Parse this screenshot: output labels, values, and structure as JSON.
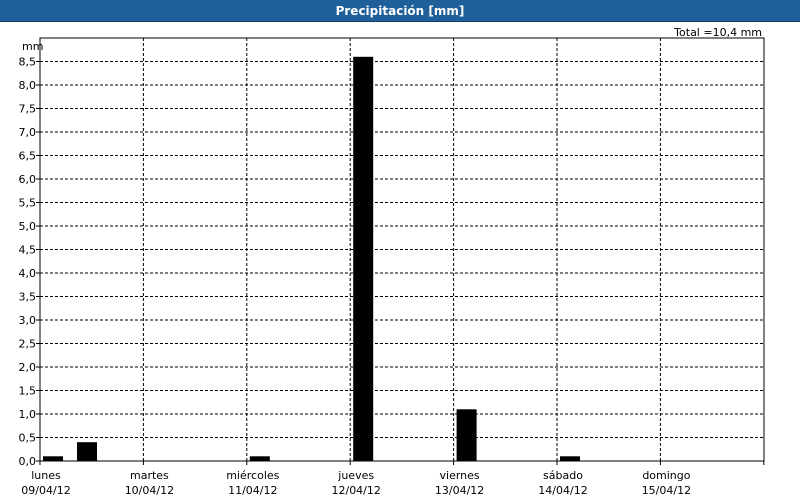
{
  "window": {
    "title": "Precipitación [mm]"
  },
  "total_label": "Total =10,4 mm",
  "chart_data": {
    "type": "bar",
    "title": "Precipitación [mm]",
    "ylabel": "mm",
    "ylim": [
      0,
      9.0
    ],
    "y_ticks": [
      "0,0",
      "0,5",
      "1,0",
      "1,5",
      "2,0",
      "2,5",
      "3,0",
      "3,5",
      "4,0",
      "4,5",
      "5,0",
      "5,5",
      "6,0",
      "6,5",
      "7,0",
      "7,5",
      "8,0",
      "8,5"
    ],
    "days": [
      {
        "name": "lunes",
        "date": "09/04/12"
      },
      {
        "name": "martes",
        "date": "10/04/12"
      },
      {
        "name": "miércoles",
        "date": "11/04/12"
      },
      {
        "name": "jueves",
        "date": "12/04/12"
      },
      {
        "name": "viernes",
        "date": "13/04/12"
      },
      {
        "name": "sábado",
        "date": "14/04/12"
      },
      {
        "name": "domingo",
        "date": "15/04/12"
      }
    ],
    "bars": [
      {
        "day": 0,
        "slot": 0,
        "value": 0.1
      },
      {
        "day": 0,
        "slot": 1,
        "value": 0.4
      },
      {
        "day": 1,
        "slot": 0,
        "value": 0.0
      },
      {
        "day": 1,
        "slot": 1,
        "value": 0.0
      },
      {
        "day": 2,
        "slot": 0,
        "value": 0.1
      },
      {
        "day": 2,
        "slot": 1,
        "value": 0.0
      },
      {
        "day": 3,
        "slot": 0,
        "value": 8.6
      },
      {
        "day": 3,
        "slot": 1,
        "value": 0.0
      },
      {
        "day": 4,
        "slot": 0,
        "value": 1.1
      },
      {
        "day": 4,
        "slot": 1,
        "value": 0.0
      },
      {
        "day": 5,
        "slot": 0,
        "value": 0.1
      },
      {
        "day": 5,
        "slot": 1,
        "value": 0.0
      },
      {
        "day": 6,
        "slot": 0,
        "value": 0.0
      },
      {
        "day": 6,
        "slot": 1,
        "value": 0.0
      }
    ],
    "grid": true,
    "bar_color": "#000000"
  }
}
